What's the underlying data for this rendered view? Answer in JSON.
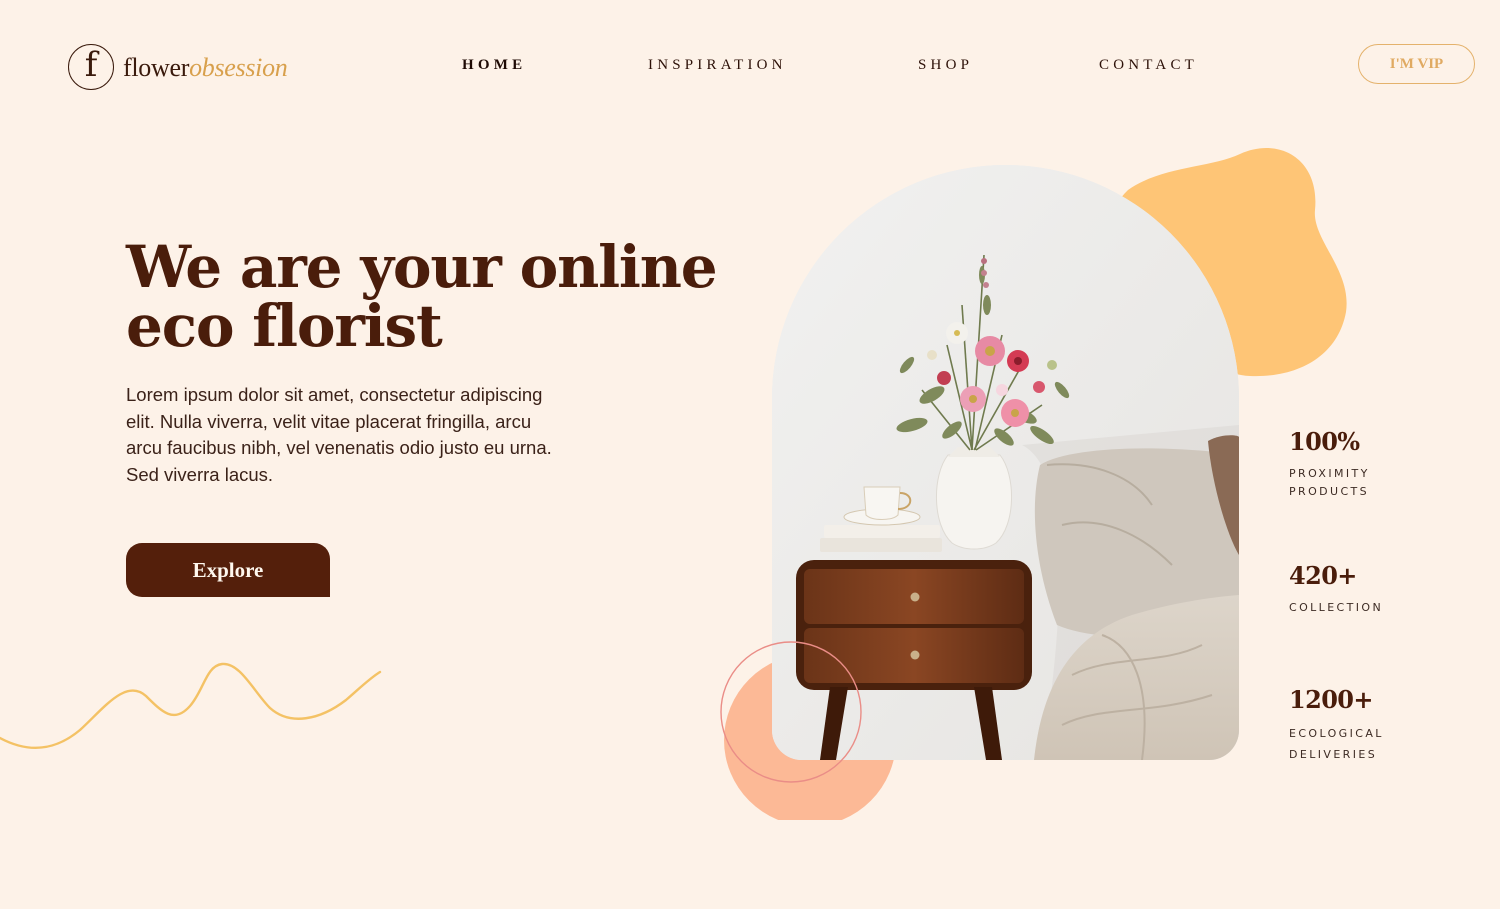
{
  "header": {
    "logo": {
      "mark": "f",
      "word_1": "flower",
      "word_2": "obsession"
    },
    "nav": [
      {
        "label": "HOME",
        "active": true
      },
      {
        "label": "INSPIRATION",
        "active": false
      },
      {
        "label": "SHOP",
        "active": false
      },
      {
        "label": "CONTACT",
        "active": false
      }
    ],
    "vip_label": "I'M VIP"
  },
  "hero": {
    "title_line_1": "We are your online",
    "title_line_2": "eco florist",
    "text": "Lorem ipsum dolor sit amet, consectetur adipiscing elit. Nulla viverra, velit vitae placerat fringilla, arcu arcu faucibus nibh, vel venenatis odio justo eu urna. Sed viverra lacus.",
    "button_label": "Explore"
  },
  "stats": [
    {
      "value": "100%",
      "label_1": "PROXIMITY",
      "label_2": "PRODUCTS"
    },
    {
      "value": "420+",
      "label_1": "COLLECTION",
      "label_2": ""
    },
    {
      "value": "1200+",
      "label_1": "ECOLOGICAL",
      "label_2": "DELIVERIES"
    }
  ],
  "colors": {
    "background": "#fdf2e8",
    "brand_brown": "#541f0b",
    "accent_gold": "#d8a04c",
    "blob_orange": "#fec576",
    "peach": "#fcb996",
    "squiggle": "#f4c265"
  }
}
